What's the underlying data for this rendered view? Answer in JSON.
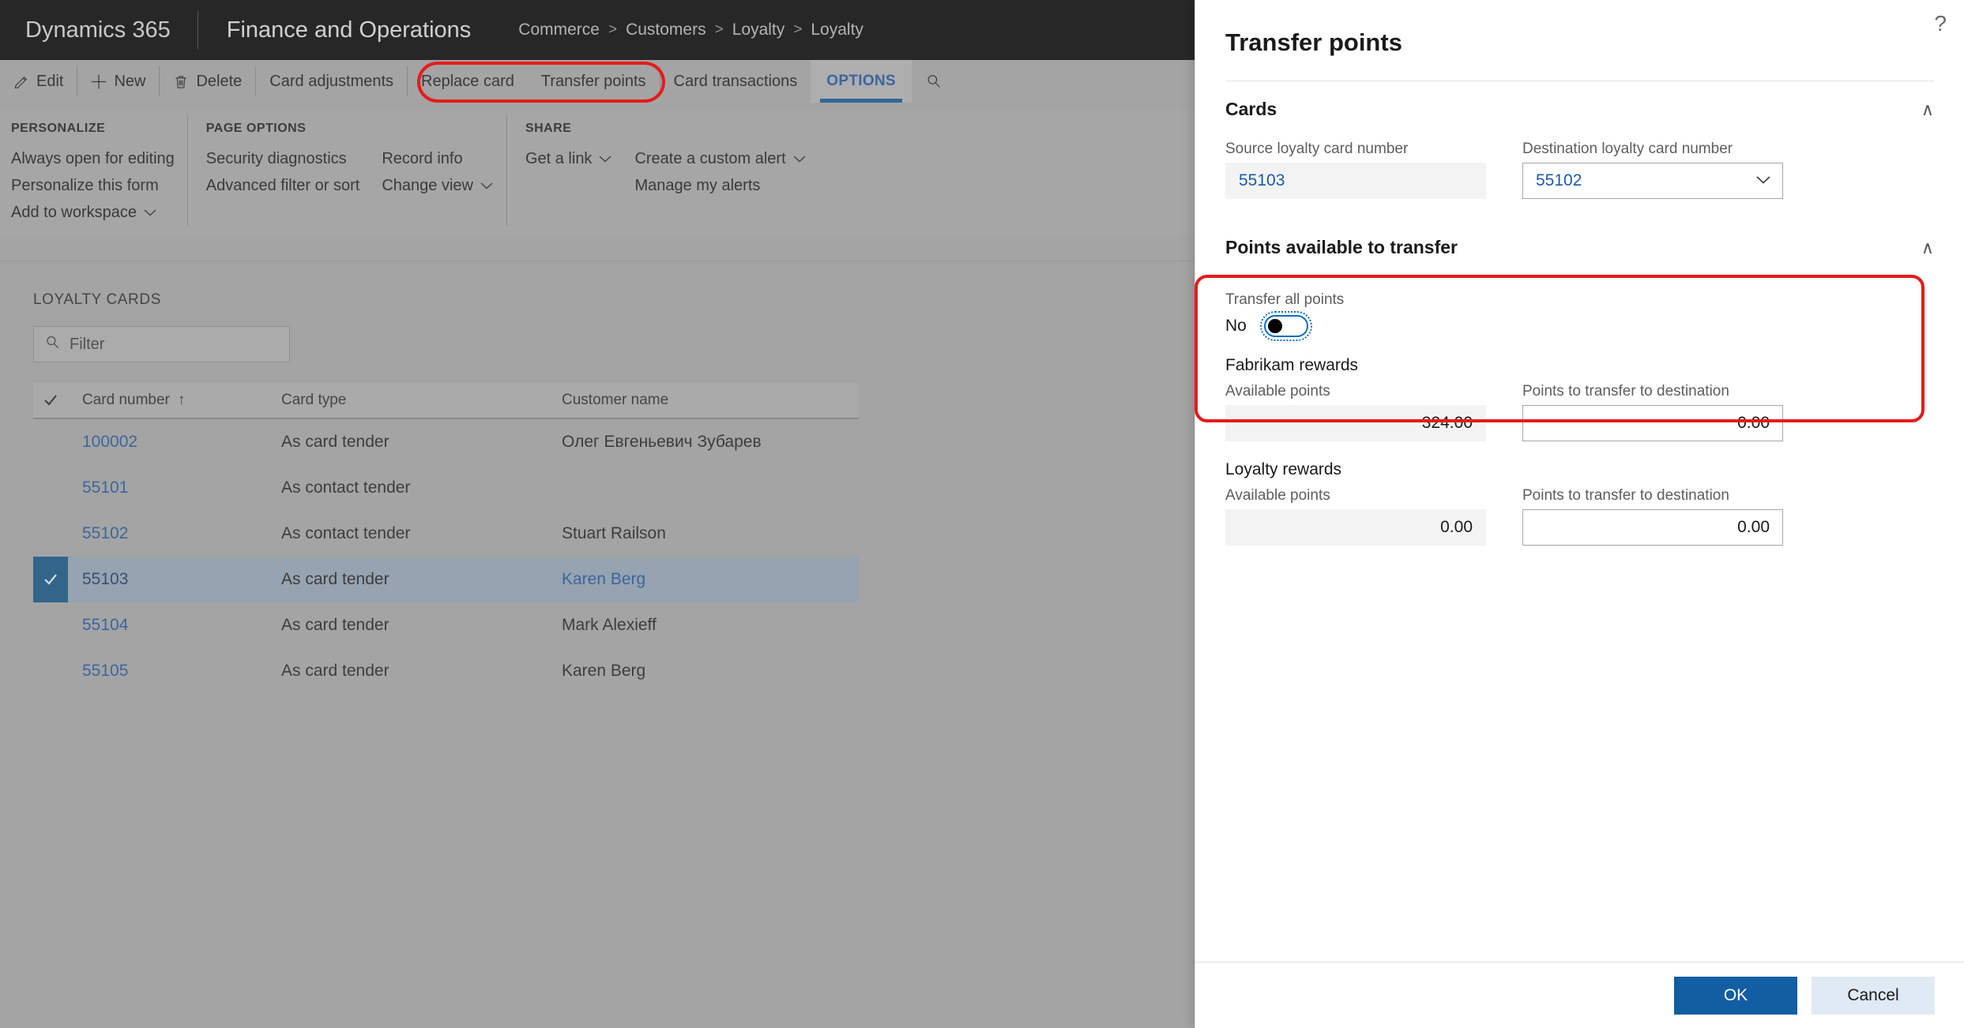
{
  "navbar": {
    "brand": "Dynamics 365",
    "app": "Finance and Operations",
    "breadcrumb": [
      "Commerce",
      "Customers",
      "Loyalty",
      "Loyalty"
    ],
    "separator": ">"
  },
  "toolbar": {
    "edit": "Edit",
    "new": "New",
    "delete": "Delete",
    "card_adjustments": "Card adjustments",
    "replace_card": "Replace card",
    "transfer_points": "Transfer points",
    "card_transactions": "Card transactions",
    "options_tab": "OPTIONS"
  },
  "options_menu": {
    "groups": [
      {
        "title": "PERSONALIZE",
        "columns": [
          [
            {
              "label": "Always open for editing",
              "caret": false
            },
            {
              "label": "Personalize this form",
              "caret": false
            },
            {
              "label": "Add to workspace",
              "caret": true
            }
          ]
        ]
      },
      {
        "title": "PAGE OPTIONS",
        "columns": [
          [
            {
              "label": "Security diagnostics",
              "caret": false
            },
            {
              "label": "Advanced filter or sort",
              "caret": false
            }
          ],
          [
            {
              "label": "Record info",
              "caret": false
            },
            {
              "label": "Change view",
              "caret": true
            }
          ]
        ]
      },
      {
        "title": "SHARE",
        "columns": [
          [
            {
              "label": "Get a link",
              "caret": true
            }
          ],
          [
            {
              "label": "Create a custom alert",
              "caret": true
            },
            {
              "label": "Manage my alerts",
              "caret": false
            }
          ]
        ]
      }
    ]
  },
  "grid": {
    "caption": "LOYALTY CARDS",
    "filter_placeholder": "Filter",
    "filter_value": "",
    "sort_indicator": "↑",
    "columns": [
      "Card number",
      "Card type",
      "Customer name"
    ],
    "rows": [
      {
        "card_number": "100002",
        "card_type": "As card tender",
        "customer_name": "Олег Евгеньевич Зубарев",
        "selected": false
      },
      {
        "card_number": "55101",
        "card_type": "As contact tender",
        "customer_name": "",
        "selected": false
      },
      {
        "card_number": "55102",
        "card_type": "As contact tender",
        "customer_name": "Stuart Railson",
        "selected": false
      },
      {
        "card_number": "55103",
        "card_type": "As card tender",
        "customer_name": "Karen Berg",
        "selected": true
      },
      {
        "card_number": "55104",
        "card_type": "As card tender",
        "customer_name": "Mark Alexieff",
        "selected": false
      },
      {
        "card_number": "55105",
        "card_type": "As card tender",
        "customer_name": "Karen Berg",
        "selected": false
      }
    ]
  },
  "flyout": {
    "title": "Transfer points",
    "help_glyph": "?",
    "cards_section": {
      "title": "Cards",
      "collapse_glyph": "∧",
      "source_label": "Source loyalty card number",
      "source_value": "55103",
      "destination_label": "Destination loyalty card number",
      "destination_value": "55102",
      "destination_caret": "∨"
    },
    "points_section": {
      "title": "Points available to transfer",
      "collapse_glyph": "∧",
      "transfer_all_label": "Transfer all points",
      "transfer_all_value": "No",
      "reward_groups": [
        {
          "name": "Fabrikam rewards",
          "available_label": "Available points",
          "available_value": "324.00",
          "transfer_label": "Points to transfer to destination",
          "transfer_value": "0.00"
        },
        {
          "name": "Loyalty rewards",
          "available_label": "Available points",
          "available_value": "0.00",
          "transfer_label": "Points to transfer to destination",
          "transfer_value": "0.00"
        }
      ]
    },
    "footer": {
      "ok": "OK",
      "cancel": "Cancel"
    }
  },
  "colors": {
    "nav_background": "#000000",
    "accent_blue": "#1e5ba8",
    "primary_button": "#115ea3",
    "secondary_button": "#dfeaf5",
    "annotation_red": "#e51b1b",
    "selected_row": "#9fb2c4",
    "selection_marker": "#11598f",
    "app_background": "#b3b3b3"
  }
}
